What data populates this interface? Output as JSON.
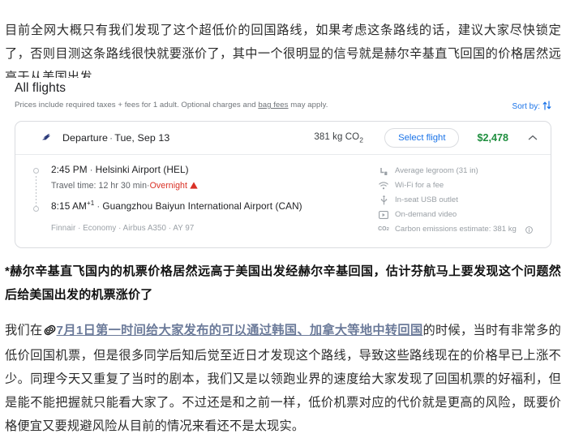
{
  "article": {
    "intro_paragraph": "目前全网大概只有我们发现了这个超低价的回国路线，如果考虑这条路线的话，建议大家尽快锁定了，否则目测这条路线很快就要涨价了，其中一个很明显的信号就是赫尔辛基直飞回国的价格居然远高于从美国出发。",
    "note_paragraph": "*赫尔辛基直飞国内的机票价格居然远高于美国出发经赫尔辛基回国，估计芬航马上要发现这个问题然后给美国出发的机票涨价了",
    "closing_prefix": "我们在",
    "closing_link_text": "7月1日第一时间给大家发布的可以通过韩国、加拿大等地中转回国",
    "closing_suffix": "的时候，当时有非常多的低价回国机票，但是很多同学后知后觉至近日才发现这个路线，导致这些路线现在的价格早已上涨不少。同理今天又重复了当时的剧本，我们又是以领跑业界的速度给大家发现了回国机票的好福利，但是能不能把握就只能看大家了。不过还是和之前一样，低价机票对应的代价就是更高的风险，既要价格便宜又要规避风险从目前的情况来看还不是太现实。",
    "link_icon_name": "link-icon"
  },
  "flights": {
    "section_title": "All flights",
    "disclaimer_prefix": "Prices include required taxes + fees for 1 adult. Optional charges and ",
    "disclaimer_link": "bag fees",
    "disclaimer_suffix": " may apply.",
    "sort_by_label": "Sort by:",
    "sort_icon_name": "sort-arrows-icon",
    "card": {
      "airline_logo_name": "finnair-logo-icon",
      "departure_label": "Departure",
      "separator": "·",
      "departure_date": "Tue, Sep 13",
      "co2_prefix": "381 kg CO",
      "co2_sub": "2",
      "select_flight_label": "Select flight",
      "price": "$2,478",
      "chevron_icon_name": "chevron-up-icon",
      "depart_time": "2:45 PM",
      "depart_airport": "Helsinki Airport (HEL)",
      "travel_time_label": "Travel time: 12 hr 30 min",
      "travel_sep": "·",
      "overnight_label": "Overnight",
      "warning_icon_name": "warning-triangle-icon",
      "arrive_time": "8:15 AM",
      "arrive_time_sup": "+1",
      "arrive_airport": "Guangzhou Baiyun International Airport (CAN)",
      "aircraft_line": "Finnair · Economy · Airbus A350 · AY 97",
      "amenities": [
        {
          "icon": "legroom-icon",
          "label": "Average legroom (31 in)"
        },
        {
          "icon": "wifi-icon",
          "label": "Wi-Fi for a fee"
        },
        {
          "icon": "usb-icon",
          "label": "In-seat USB outlet"
        },
        {
          "icon": "video-icon",
          "label": "On-demand video"
        },
        {
          "icon": "co2-icon",
          "label": "Carbon emissions estimate: 381 kg",
          "info_icon": "info-icon"
        }
      ]
    }
  },
  "colors": {
    "link_blue": "#1a73e8",
    "price_green": "#1e8e3e",
    "warning_red": "#d93025",
    "muted_gray": "#9aa0a6",
    "border_gray": "#dadce0",
    "finnair_navy": "#2b3a7a",
    "inline_link_slate": "#6b7a99"
  }
}
